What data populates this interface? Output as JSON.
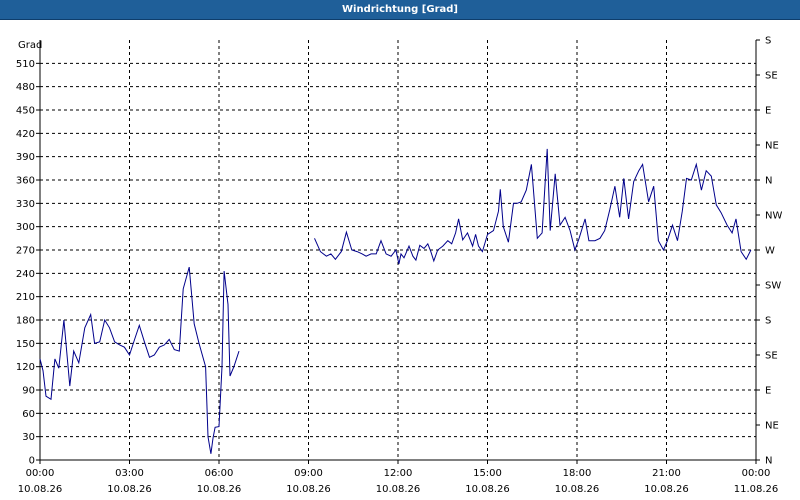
{
  "window": {
    "title": "Windrichtung [Grad]"
  },
  "chart_data": {
    "type": "line",
    "ylabel": "Grad",
    "ylim": [
      0,
      540
    ],
    "y_ticks": [
      0,
      30,
      60,
      90,
      120,
      150,
      180,
      210,
      240,
      270,
      300,
      330,
      360,
      390,
      420,
      450,
      480,
      510
    ],
    "right_axis_labels": [
      {
        "value": 0,
        "label": "N"
      },
      {
        "value": 45,
        "label": "NE"
      },
      {
        "value": 90,
        "label": "E"
      },
      {
        "value": 135,
        "label": "SE"
      },
      {
        "value": 180,
        "label": "S"
      },
      {
        "value": 225,
        "label": "SW"
      },
      {
        "value": 270,
        "label": "W"
      },
      {
        "value": 315,
        "label": "NW"
      },
      {
        "value": 360,
        "label": "N"
      },
      {
        "value": 405,
        "label": "NE"
      },
      {
        "value": 450,
        "label": "E"
      },
      {
        "value": 495,
        "label": "SE"
      },
      {
        "value": 540,
        "label": "S"
      }
    ],
    "x_range_hours": [
      0,
      24
    ],
    "x_ticks": [
      {
        "hour": 0,
        "time": "00:00",
        "date": "10.08.26"
      },
      {
        "hour": 3,
        "time": "03:00",
        "date": "10.08.26"
      },
      {
        "hour": 6,
        "time": "06:00",
        "date": "10.08.26"
      },
      {
        "hour": 9,
        "time": "09:00",
        "date": "10.08.26"
      },
      {
        "hour": 12,
        "time": "12:00",
        "date": "10.08.26"
      },
      {
        "hour": 15,
        "time": "15:00",
        "date": "10.08.26"
      },
      {
        "hour": 18,
        "time": "18:00",
        "date": "10.08.26"
      },
      {
        "hour": 21,
        "time": "21:00",
        "date": "10.08.26"
      },
      {
        "hour": 24,
        "time": "00:00",
        "date": "11.08.26"
      }
    ],
    "grid": true,
    "line_color": "#00008b",
    "series": [
      {
        "segments": [
          [
            [
              0.0,
              130
            ],
            [
              0.1,
              115
            ],
            [
              0.2,
              82
            ],
            [
              0.37,
              78
            ],
            [
              0.5,
              130
            ],
            [
              0.63,
              118
            ],
            [
              0.8,
              180
            ],
            [
              1.0,
              95
            ],
            [
              1.13,
              140
            ],
            [
              1.3,
              125
            ],
            [
              1.5,
              170
            ],
            [
              1.7,
              187
            ],
            [
              1.83,
              150
            ],
            [
              2.0,
              152
            ],
            [
              2.17,
              180
            ],
            [
              2.33,
              170
            ],
            [
              2.5,
              152
            ],
            [
              2.67,
              148
            ],
            [
              2.83,
              145
            ],
            [
              3.0,
              135
            ],
            [
              3.17,
              155
            ],
            [
              3.33,
              173
            ],
            [
              3.5,
              152
            ],
            [
              3.67,
              132
            ],
            [
              3.83,
              135
            ],
            [
              4.0,
              145
            ],
            [
              4.17,
              148
            ],
            [
              4.33,
              155
            ],
            [
              4.5,
              142
            ],
            [
              4.67,
              140
            ],
            [
              4.8,
              220
            ],
            [
              5.0,
              248
            ],
            [
              5.17,
              175
            ],
            [
              5.33,
              150
            ],
            [
              5.55,
              120
            ],
            [
              5.63,
              30
            ],
            [
              5.73,
              8
            ],
            [
              5.8,
              28
            ],
            [
              5.87,
              42
            ],
            [
              6.0,
              43
            ],
            [
              6.1,
              120
            ],
            [
              6.17,
              243
            ],
            [
              6.3,
              200
            ],
            [
              6.37,
              108
            ],
            [
              6.5,
              120
            ],
            [
              6.67,
              140
            ]
          ],
          [
            [
              9.2,
              285
            ],
            [
              9.4,
              268
            ],
            [
              9.6,
              262
            ],
            [
              9.75,
              265
            ],
            [
              9.9,
              258
            ],
            [
              10.1,
              268
            ],
            [
              10.27,
              293
            ],
            [
              10.45,
              270
            ],
            [
              10.63,
              268
            ],
            [
              10.8,
              265
            ],
            [
              10.93,
              262
            ],
            [
              11.1,
              265
            ],
            [
              11.27,
              265
            ],
            [
              11.43,
              282
            ],
            [
              11.6,
              265
            ],
            [
              11.77,
              262
            ],
            [
              11.93,
              270
            ],
            [
              12.03,
              252
            ],
            [
              12.1,
              265
            ],
            [
              12.2,
              260
            ],
            [
              12.37,
              275
            ],
            [
              12.5,
              262
            ],
            [
              12.6,
              257
            ],
            [
              12.73,
              276
            ],
            [
              12.87,
              272
            ],
            [
              13.0,
              278
            ],
            [
              13.1,
              268
            ],
            [
              13.2,
              256
            ],
            [
              13.33,
              270
            ],
            [
              13.5,
              275
            ],
            [
              13.67,
              282
            ],
            [
              13.8,
              278
            ],
            [
              13.93,
              292
            ],
            [
              14.03,
              310
            ],
            [
              14.17,
              283
            ],
            [
              14.33,
              292
            ],
            [
              14.5,
              275
            ],
            [
              14.6,
              290
            ],
            [
              14.7,
              275
            ],
            [
              14.83,
              268
            ],
            [
              15.0,
              290
            ],
            [
              15.2,
              295
            ],
            [
              15.37,
              320
            ],
            [
              15.43,
              348
            ],
            [
              15.53,
              300
            ],
            [
              15.7,
              280
            ],
            [
              15.87,
              330
            ],
            [
              16.0,
              330
            ],
            [
              16.13,
              332
            ],
            [
              16.3,
              347
            ],
            [
              16.47,
              380
            ],
            [
              16.67,
              285
            ],
            [
              16.83,
              292
            ],
            [
              17.0,
              400
            ],
            [
              17.1,
              295
            ],
            [
              17.27,
              368
            ],
            [
              17.43,
              302
            ],
            [
              17.6,
              312
            ],
            [
              17.77,
              295
            ],
            [
              17.93,
              270
            ],
            [
              18.07,
              285
            ],
            [
              18.27,
              310
            ],
            [
              18.4,
              282
            ],
            [
              18.6,
              282
            ],
            [
              18.77,
              285
            ],
            [
              18.93,
              295
            ],
            [
              19.1,
              322
            ],
            [
              19.27,
              352
            ],
            [
              19.43,
              312
            ],
            [
              19.57,
              362
            ],
            [
              19.73,
              310
            ],
            [
              19.9,
              358
            ],
            [
              20.07,
              372
            ],
            [
              20.2,
              380
            ],
            [
              20.4,
              332
            ],
            [
              20.57,
              352
            ],
            [
              20.73,
              282
            ],
            [
              20.9,
              270
            ],
            [
              21.03,
              282
            ],
            [
              21.2,
              302
            ],
            [
              21.37,
              282
            ],
            [
              21.53,
              320
            ],
            [
              21.67,
              362
            ],
            [
              21.83,
              360
            ],
            [
              22.0,
              380
            ],
            [
              22.17,
              347
            ],
            [
              22.33,
              372
            ],
            [
              22.5,
              365
            ],
            [
              22.67,
              328
            ],
            [
              22.83,
              318
            ],
            [
              23.03,
              302
            ],
            [
              23.2,
              292
            ],
            [
              23.33,
              310
            ],
            [
              23.5,
              268
            ],
            [
              23.67,
              258
            ],
            [
              23.83,
              270
            ]
          ]
        ]
      }
    ]
  }
}
